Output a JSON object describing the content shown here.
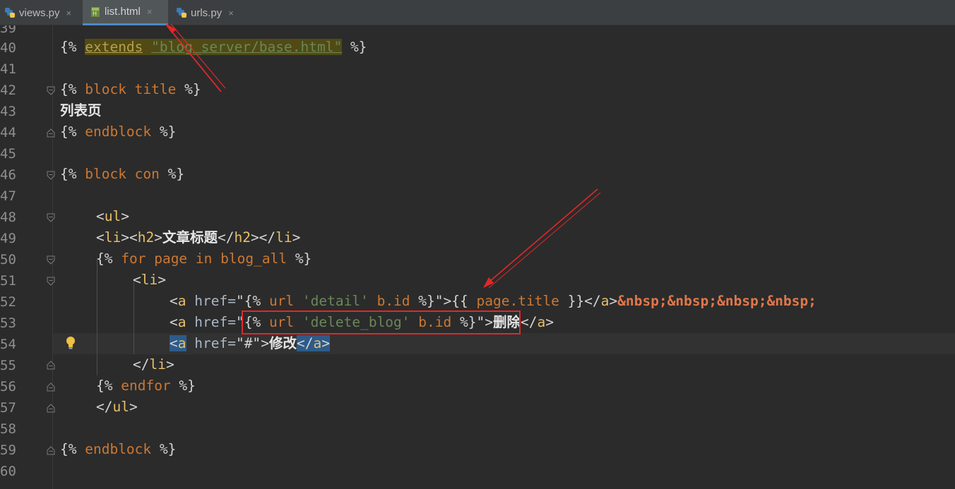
{
  "tabs": [
    {
      "label": "views.py",
      "icon": "python-file-icon",
      "close": "×"
    },
    {
      "label": "list.html",
      "icon": "html-file-icon",
      "close": "×",
      "active": true
    },
    {
      "label": "urls.py",
      "icon": "python-file-icon",
      "close": "×"
    }
  ],
  "line_numbers": [
    "39",
    "40",
    "41",
    "42",
    "43",
    "44",
    "45",
    "46",
    "47",
    "48",
    "49",
    "50",
    "51",
    "52",
    "53",
    "54",
    "55",
    "56",
    "57",
    "58",
    "59",
    "60"
  ],
  "code": {
    "l40_open": "{% ",
    "l40_extends": "extends",
    "l40_space": " ",
    "l40_path": "\"blog_server/base.html\"",
    "l40_close": " %}",
    "l42_open": "{% ",
    "l42_block": "block title",
    "l42_close": " %}",
    "l43_text": "列表页",
    "l44_open": "{% ",
    "l44_endblock": "endblock",
    "l44_close": " %}",
    "l46_open": "{% ",
    "l46_block": "block con",
    "l46_close": " %}",
    "l48_lt": "<",
    "l48_tag": "ul",
    "l48_gt": ">",
    "l49_lt1": "<",
    "l49_tag1": "li",
    "l49_gt1": "><",
    "l49_tag2": "h2",
    "l49_gt2": ">",
    "l49_text": "文章标题",
    "l49_lt3": "</",
    "l49_tag3": "h2",
    "l49_gt3": "></",
    "l49_tag4": "li",
    "l49_gt4": ">",
    "l50_open": "{% ",
    "l50_for": "for",
    "l50_page": " page ",
    "l50_in": "in",
    "l50_var": " blog_all ",
    "l50_close": "%}",
    "l51_lt": "<",
    "l51_tag": "li",
    "l51_gt": ">",
    "l52_lt": "<",
    "l52_tag": "a",
    "l52_attr": " href=",
    "l52_q1": "\"",
    "l52_d1": "{% ",
    "l52_url": "url",
    "l52_str": " 'detail' ",
    "l52_bid": "b.id ",
    "l52_d2": "%}",
    "l52_q2": "\"",
    "l52_gt": ">",
    "l52_v1": "{{ ",
    "l52_ptitle": "page.title",
    "l52_v2": " }}",
    "l52_lt2": "</",
    "l52_tag2": "a",
    "l52_gt2": ">",
    "l52_nbsp": "&nbsp;&nbsp;&nbsp;&nbsp;",
    "l53_lt": "<",
    "l53_tag": "a",
    "l53_attr": " href=",
    "l53_q1": "\"",
    "l53_d1": "{% ",
    "l53_url": "url",
    "l53_str": " 'delete_blog' ",
    "l53_bid": "b.id ",
    "l53_d2": "%}",
    "l53_q2": "\"",
    "l53_gt": ">",
    "l53_text": "删除",
    "l53_lt2": "</",
    "l53_tag2": "a",
    "l53_gt2": ">",
    "l54_lt": "<",
    "l54_tag": "a",
    "l54_attr": " href=",
    "l54_val": "\"#\"",
    "l54_gt": ">",
    "l54_text": "修改",
    "l54_lt2": "</",
    "l54_tag2": "a",
    "l54_gt2": ">",
    "l55_lt": "</",
    "l55_tag": "li",
    "l55_gt": ">",
    "l56_open": "{% ",
    "l56_endfor": "endfor",
    "l56_close": " %}",
    "l57_lt": "</",
    "l57_tag": "ul",
    "l57_gt": ">",
    "l59_open": "{% ",
    "l59_endblock": "endblock",
    "l59_close": " %}"
  },
  "colors": {
    "annotation": "#e0282a",
    "selection": "#214283",
    "caret_line": "#323232",
    "bulb": "#f0c040"
  }
}
